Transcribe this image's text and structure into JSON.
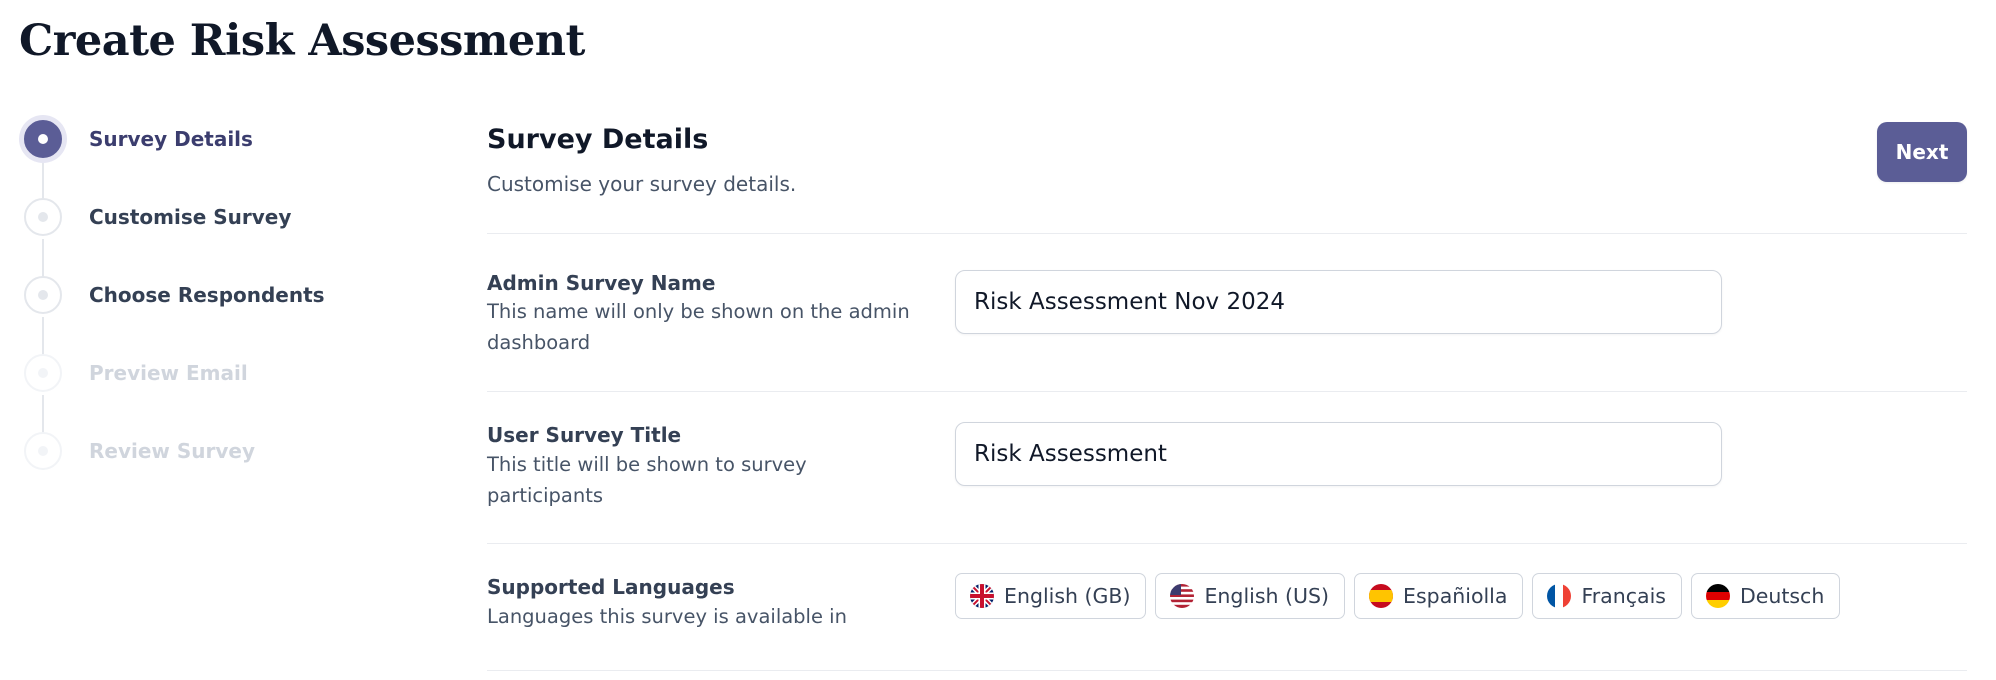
{
  "page": {
    "title": "Create Risk Assessment"
  },
  "stepper": {
    "steps": [
      {
        "label": "Survey Details",
        "state": "active"
      },
      {
        "label": "Customise Survey",
        "state": "todo"
      },
      {
        "label": "Choose Respondents",
        "state": "todo"
      },
      {
        "label": "Preview Email",
        "state": "disabled"
      },
      {
        "label": "Review Survey",
        "state": "disabled"
      }
    ]
  },
  "section": {
    "title": "Survey Details",
    "subtitle": "Customise your survey details.",
    "next_label": "Next"
  },
  "fields": {
    "admin_name": {
      "label": "Admin Survey Name",
      "hint": "This name will only be shown on the admin dashboard",
      "value": "Risk Assessment Nov 2024"
    },
    "user_title": {
      "label": "User Survey Title",
      "hint": "This title will be shown to survey participants",
      "value": "Risk Assessment"
    },
    "languages": {
      "label": "Supported Languages",
      "hint": "Languages this survey is available in",
      "items": [
        {
          "label": "English (GB)",
          "icon": "uk-flag-icon"
        },
        {
          "label": "English (US)",
          "icon": "us-flag-icon"
        },
        {
          "label": "Españiolla",
          "icon": "spain-flag-icon"
        },
        {
          "label": "Français",
          "icon": "france-flag-icon"
        },
        {
          "label": "Deutsch",
          "icon": "germany-flag-icon"
        }
      ]
    }
  },
  "colors": {
    "accent": "#5b5d96",
    "text": "#101828",
    "muted": "#475467",
    "border": "#d0d5dd"
  }
}
